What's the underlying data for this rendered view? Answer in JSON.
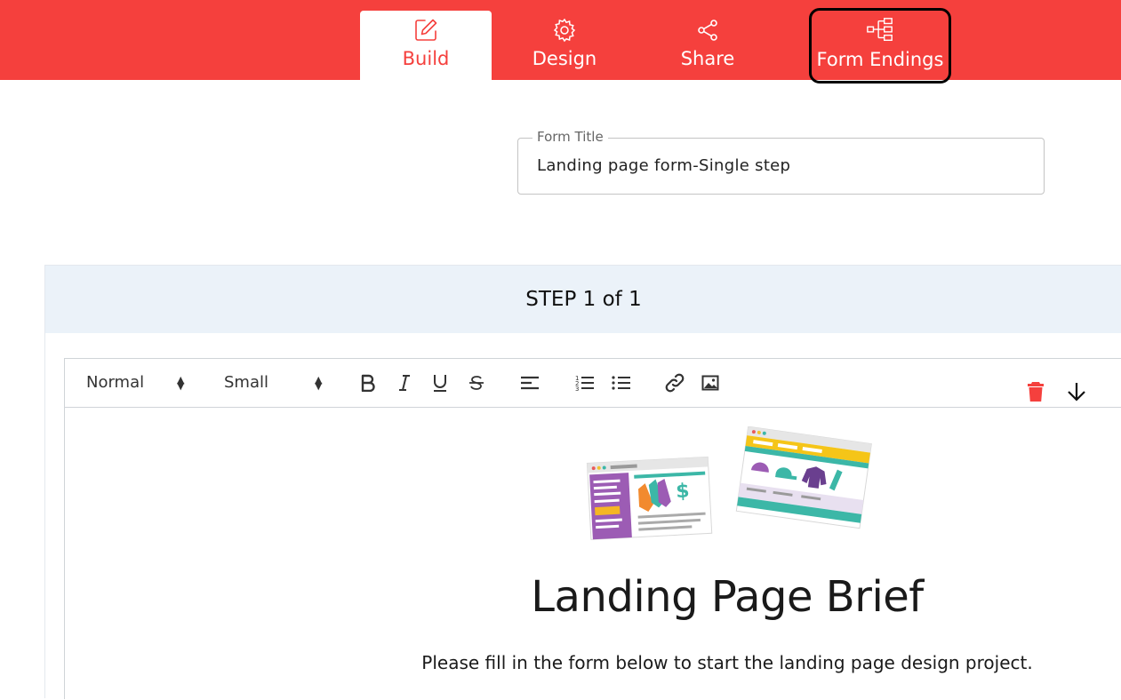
{
  "nav": {
    "tabs": [
      {
        "label": "Build",
        "icon": "pencil-square-icon",
        "active": true
      },
      {
        "label": "Design",
        "icon": "gear-icon",
        "active": false
      },
      {
        "label": "Share",
        "icon": "share-icon",
        "active": false
      },
      {
        "label": "Form Endings",
        "icon": "flow-diagram-icon",
        "active": false
      }
    ],
    "bar_color": "#f5403d"
  },
  "form_title": {
    "label": "Form Title",
    "value": "Landing page form-Single step"
  },
  "step": {
    "header": "STEP 1 of 1"
  },
  "toolbar": {
    "header_select": "Normal",
    "size_select": "Small",
    "buttons": [
      "bold-icon",
      "italic-icon",
      "underline-icon",
      "strikethrough-icon",
      "align-left-icon",
      "ordered-list-icon",
      "bullet-list-icon",
      "link-icon",
      "image-icon"
    ],
    "delete_color": "#f5403d"
  },
  "content": {
    "title": "Landing Page Brief",
    "subtitle": "Please fill in the form below to start the landing page design project."
  }
}
